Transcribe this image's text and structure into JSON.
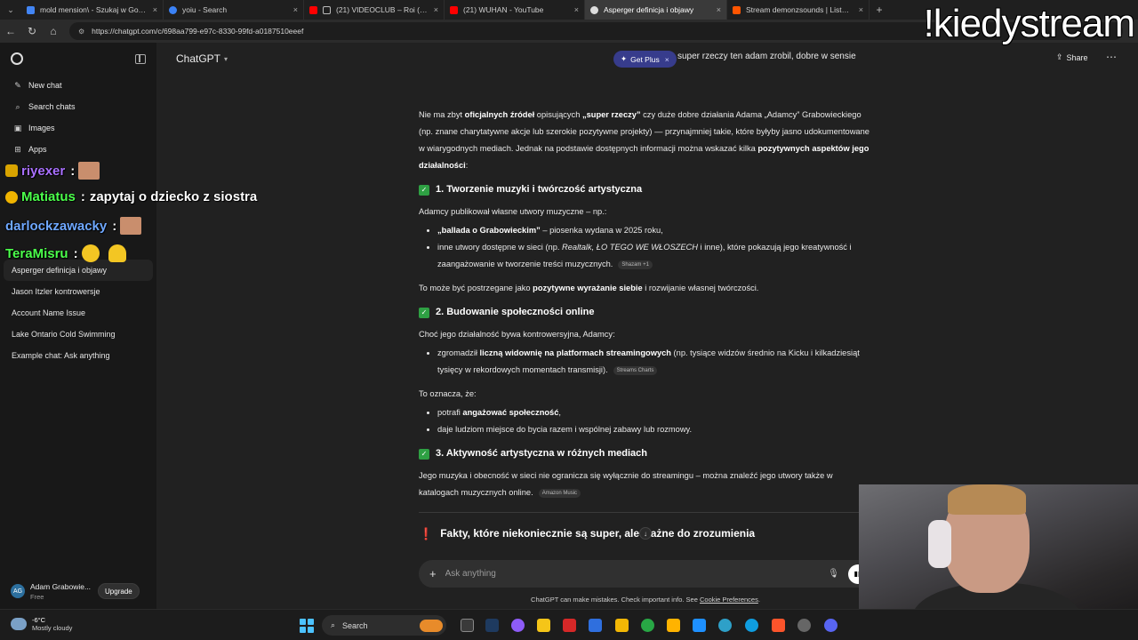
{
  "browser": {
    "tabs": [
      {
        "label": "mold mension\\ - Szukaj w Google",
        "color": "#4285f4",
        "active": false
      },
      {
        "label": "yoiu - Search",
        "color": "#3b82f6",
        "active": false
      },
      {
        "label": "(21) VIDEOCLUB – Roi (instru",
        "color": "#ff0000",
        "active": false
      },
      {
        "label": "(21) WUHAN - YouTube",
        "color": "#ff0000",
        "active": false
      },
      {
        "label": "Asperger definicja i objawy",
        "color": "#dddddd",
        "active": true
      },
      {
        "label": "Stream demonzsounds | Listen to",
        "color": "#ff5500",
        "active": false
      }
    ],
    "tab_close": "×",
    "new_tab": "+",
    "url": "https://chatgpt.com/c/698aa799-e97c-8330-99fd-a0187510eeef"
  },
  "stream_overlay": "!kiedystream",
  "sidebar": {
    "nav": [
      {
        "label": "New chat",
        "icon": "✎"
      },
      {
        "label": "Search chats",
        "icon": "⌕"
      },
      {
        "label": "Images",
        "icon": "▣"
      },
      {
        "label": "Apps",
        "icon": "⊞"
      }
    ],
    "chats": [
      "Asperger definicja i objawy",
      "Jason Itzler kontrowersje",
      "Account Name Issue",
      "Lake Ontario Cold Swimming",
      "Example chat: Ask anything"
    ],
    "user": {
      "initials": "AG",
      "name": "Adam Grabowie...",
      "plan": "Free",
      "upgrade": "Upgrade"
    }
  },
  "stream_chat": [
    {
      "user": "riyexer",
      "text": "",
      "color": "#a970ff"
    },
    {
      "user": "Matiatus",
      "text": "zapytaj o dziecko z siostra",
      "color": "#4cff4c"
    },
    {
      "user": "darlockzawacky",
      "text": "",
      "color": "#6fa8ff"
    },
    {
      "user": "TeraMisru",
      "text": "",
      "color": "#4cff4c"
    }
  ],
  "chat_sep": ":",
  "header": {
    "model": "ChatGPT",
    "get_plus": "Get Plus",
    "get_plus_close": "×",
    "title": "super rzeczy ten adam zrobil, dobre w sensie",
    "share": "Share",
    "more": "⋯"
  },
  "conversation": {
    "intro": {
      "t1": "Nie ma zbyt ",
      "b1": "oficjalnych źródeł",
      "t2": " opisujących ",
      "b2": "„super rzeczy”",
      "t3": " czy duże dobre działania Adama „Adamcy” Grabowieckiego (np. znane charytatywne akcje lub szerokie pozytywne projekty) — przynajmniej takie, które byłyby jasno udokumentowane w wiarygodnych mediach. Jednak na podstawie dostępnych informacji można wskazać kilka ",
      "b3": "pozytywnych aspektów jego działalności",
      "t4": ":"
    },
    "s1": {
      "heading": "1. Tworzenie muzyki i twórczość artystyczna",
      "lead": "Adamcy publikował własne utwory muzyczne – np.:",
      "li1_b": "„ballada o Grabowieckim”",
      "li1_t": " – piosenka wydana w 2025 roku,",
      "li2_t1": "inne utwory dostępne w sieci (np. ",
      "li2_i": "Realtalk, ŁO TEGO WE WŁOSZECH",
      "li2_t2": " i inne), które pokazują jego kreatywność i zaangażowanie w tworzenie treści muzycznych.",
      "li2_src": "Shazam +1",
      "close_t1": "To może być postrzegane jako ",
      "close_b": "pozytywne wyrażanie siebie",
      "close_t2": " i rozwijanie własnej twórczości."
    },
    "s2": {
      "heading": "2. Budowanie społeczności online",
      "lead": "Choć jego działalność bywa kontrowersyjna, Adamcy:",
      "li1_t1": "zgromadził ",
      "li1_b": "liczną widownię na platformach streamingowych",
      "li1_t2": " (np. tysiące widzów średnio na Kicku i kilkadziesiąt tysięcy w rekordowych momentach transmisji).",
      "li1_src": "Streams Charts",
      "lead2": "To oznacza, że:",
      "li2_t1": "potrafi ",
      "li2_b": "angażować społeczność",
      "li2_t2": ",",
      "li3": "daje ludziom miejsce do bycia razem i wspólnej zabawy lub rozmowy."
    },
    "s3": {
      "heading": "3. Aktywność artystyczna w różnych mediach",
      "text": "Jego muzyka i obecność w sieci nie ogranicza się wyłącznie do streamingu – można znaleźć jego utwory także w katalogach muzycznych online.",
      "src": "Amazon Music"
    },
    "warn": "Fakty, które niekoniecznie są super, ale ważne do zrozumienia",
    "check": "✓",
    "bang": "❗",
    "scroll": "↓"
  },
  "composer": {
    "placeholder": "Ask anything",
    "plus": "+",
    "mic": "🎙",
    "voice": "▮▮"
  },
  "disclaimer": {
    "text": "ChatGPT can make mistakes. Check important info. See ",
    "link": "Cookie Preferences",
    "end": "."
  },
  "taskbar": {
    "temp": "-6°C",
    "condition": "Mostly cloudy",
    "search": "Search",
    "search_icon": "⌕"
  }
}
